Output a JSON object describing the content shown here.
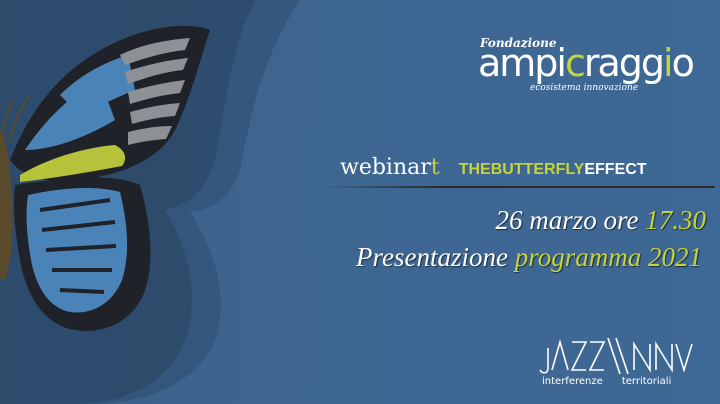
{
  "logo": {
    "fondazione": "Fondazione",
    "main_pre": "ampi",
    "main_c1": "c",
    "main_mid": "ragg",
    "main_i": "i",
    "main_end": "o",
    "tagline": "ecosistema innovazione",
    "highlight_color": "#c7d33a"
  },
  "header": {
    "webinar_pre": "webinar",
    "webinar_t": "t",
    "tbe_pre": "THEBUTTERFLY",
    "tbe_post": "EFFECT"
  },
  "event": {
    "date_text": "26 marzo ore ",
    "time": "17.30",
    "presentation": "Presentazione ",
    "program": "programma 2021"
  },
  "jazz_logo": {
    "caption_left": "interferenze",
    "caption_right": "territoriali"
  },
  "colors": {
    "background": "#3d6590",
    "accent": "#c7d33a",
    "wing_dark": "#1f2228",
    "wing_blue": "#4a83b8"
  }
}
